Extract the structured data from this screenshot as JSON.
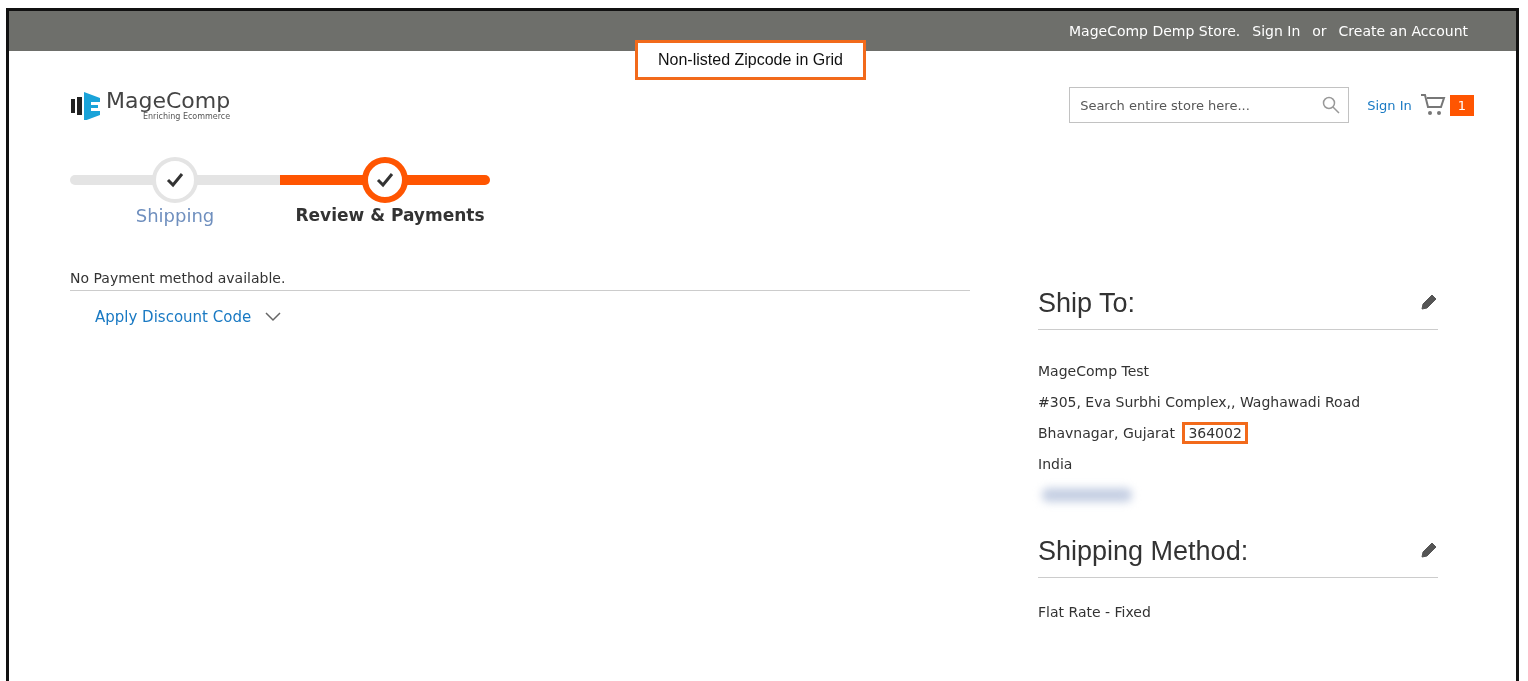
{
  "top_bar": {
    "welcome": "MageComp Demp Store.",
    "sign_in": "Sign In",
    "separator": "or",
    "create_account": "Create an Account"
  },
  "callout": {
    "text": "Non-listed Zipcode in Grid"
  },
  "logo": {
    "name": "MageComp",
    "tagline": "Enriching Ecommerce"
  },
  "search": {
    "placeholder": "Search entire store here..."
  },
  "cart": {
    "count": "1",
    "overlap_link": "Sign In"
  },
  "progress": [
    {
      "label": "Shipping",
      "current": false
    },
    {
      "label": "Review & Payments",
      "current": true
    }
  ],
  "payment": {
    "message": "No Payment method available.",
    "discount_link": "Apply Discount Code",
    "discount_expanded": false
  },
  "ship_to": {
    "title": "Ship To:",
    "lines": [
      {
        "text": "MageComp Test"
      },
      {
        "text": "#305, Eva Surbhi Complex,, Waghawadi Road"
      },
      {
        "text": "Bhavnagar, Gujarat",
        "zip": "364002",
        "zip_highlighted": true
      },
      {
        "text": "India"
      }
    ],
    "phone_redacted": true
  },
  "shipping_method": {
    "title": "Shipping Method:",
    "value": "Flat Rate - Fixed"
  }
}
